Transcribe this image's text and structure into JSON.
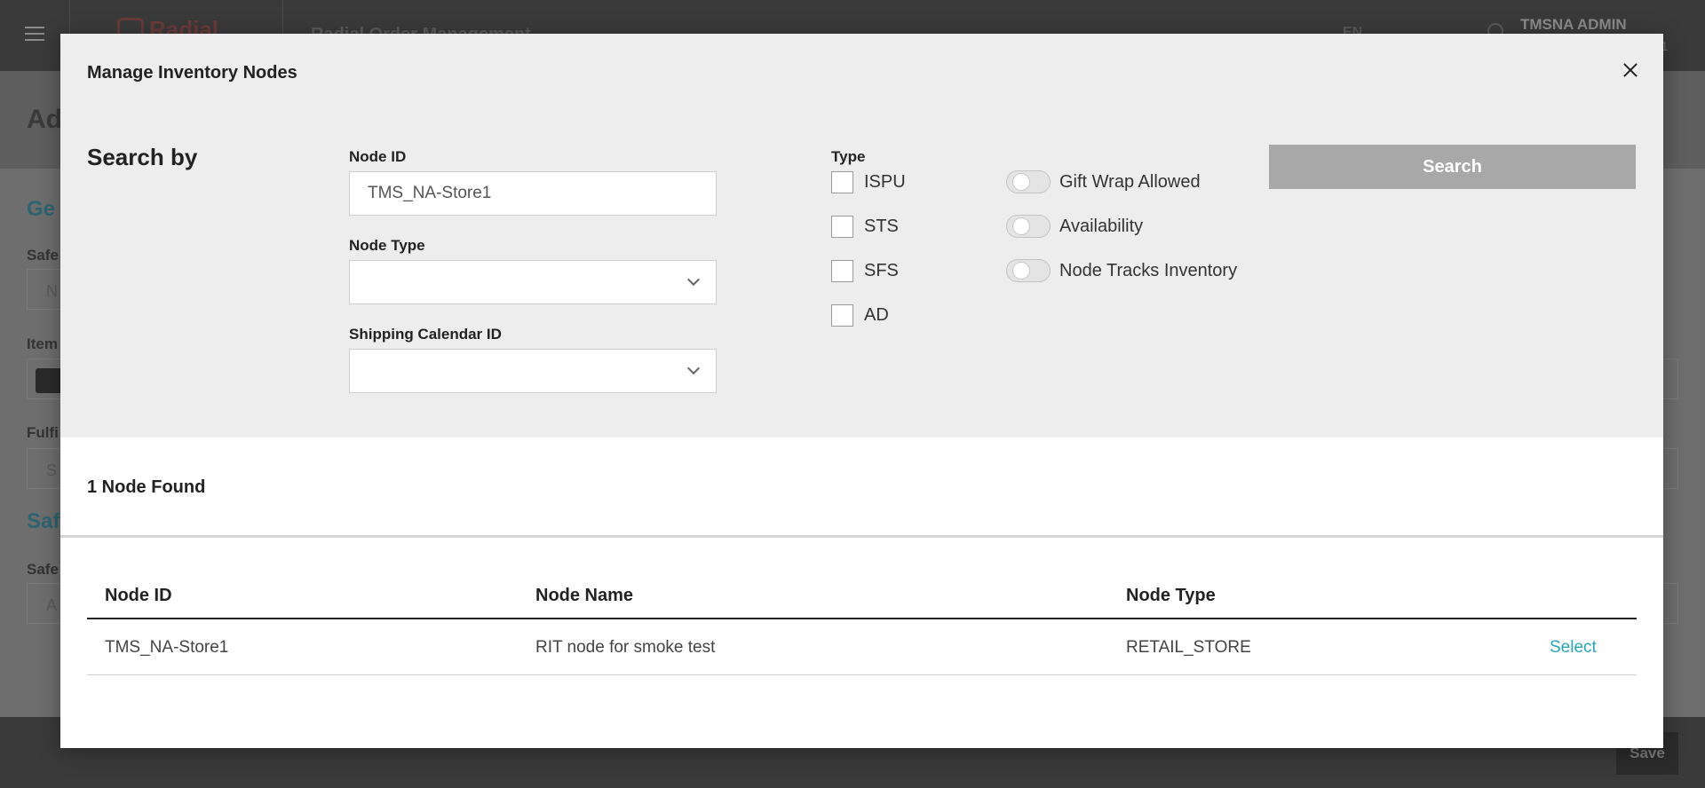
{
  "background": {
    "logo": "Radial",
    "app_title": "Radial Order Management",
    "language": "EN",
    "user_name": "TMSNA ADMIN",
    "user_sub": "801",
    "page_title": "Ad",
    "section_general": "Ge",
    "label_safety": "Safe",
    "input_safety_placeholder": "N",
    "label_item": "Item",
    "label_fulfillment": "Fulfi",
    "input_fulfillment_placeholder": "S",
    "section_safety": "Saf",
    "label_safety2": "Safe",
    "input_safety2_placeholder": "A",
    "save_label": "Save"
  },
  "modal": {
    "title": "Manage Inventory Nodes",
    "search_by": "Search by",
    "node_id": {
      "label": "Node ID",
      "value": "TMS_NA-Store1"
    },
    "node_type": {
      "label": "Node Type",
      "selected": ""
    },
    "shipping_calendar": {
      "label": "Shipping Calendar ID",
      "selected": ""
    },
    "type_label": "Type",
    "types": [
      "ISPU",
      "STS",
      "SFS",
      "AD"
    ],
    "toggles": [
      "Gift Wrap Allowed",
      "Availability",
      "Node Tracks Inventory"
    ],
    "search_button": "Search"
  },
  "results": {
    "count_text": "1 Node Found",
    "columns": [
      "Node ID",
      "Node Name",
      "Node Type"
    ],
    "rows": [
      {
        "node_id": "TMS_NA-Store1",
        "node_name": "RIT node for smoke test",
        "node_type": "RETAIL_STORE",
        "action": "Select"
      }
    ]
  },
  "colors": {
    "modal_top_bg": "#ededed",
    "search_button_bg": "#a8a8a8",
    "link": "#2aa5b8"
  }
}
